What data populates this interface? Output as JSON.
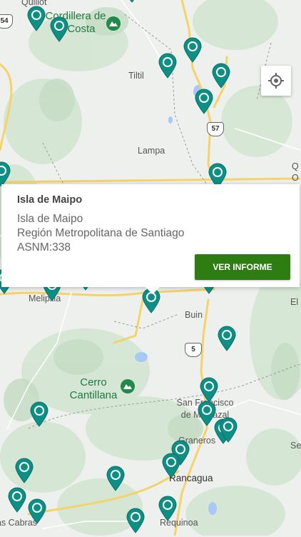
{
  "map": {
    "places": [
      {
        "id": "quillota",
        "name": "Quillot",
        "kind": "town"
      },
      {
        "id": "tiltil",
        "name": "Tiltil",
        "kind": "town"
      },
      {
        "id": "lampa",
        "name": "Lampa",
        "kind": "town"
      },
      {
        "id": "melipilla",
        "name": "Melipilla",
        "kind": "town"
      },
      {
        "id": "buin",
        "name": "Buin",
        "kind": "town"
      },
      {
        "id": "sanfrancisco",
        "name": "San Francisco de Mostazal",
        "kind": "town"
      },
      {
        "id": "graneros",
        "name": "Graneros",
        "kind": "town"
      },
      {
        "id": "rancagua",
        "name": "Rancagua",
        "kind": "town"
      },
      {
        "id": "requinoa",
        "name": "Requinoa",
        "kind": "town"
      },
      {
        "id": "lascabras",
        "name": "Las Cabras",
        "kind": "town"
      }
    ],
    "edge_text": [
      {
        "id": "edge-q",
        "text": "Q"
      },
      {
        "id": "edge-o",
        "text": "O"
      },
      {
        "id": "edge-el",
        "text": "El"
      },
      {
        "id": "edge-se",
        "text": "Se"
      }
    ],
    "parks": [
      {
        "id": "cordillera",
        "name": "Cordillera de la Costa"
      },
      {
        "id": "cantillana",
        "name": "Cerro Cantillana"
      }
    ],
    "route_shields": [
      "54",
      "57",
      "5"
    ],
    "marker_color": "#0d8f86",
    "marker_count": 34
  },
  "controls": {
    "locate_icon": "my-location-icon"
  },
  "popup": {
    "title": "Isla de Maipo",
    "lines": [
      "Isla de Maipo",
      "Región Metropolitana de Santiago",
      "ASNM:338"
    ],
    "button_label": "VER INFORME",
    "button_color": "#2d7d12"
  }
}
